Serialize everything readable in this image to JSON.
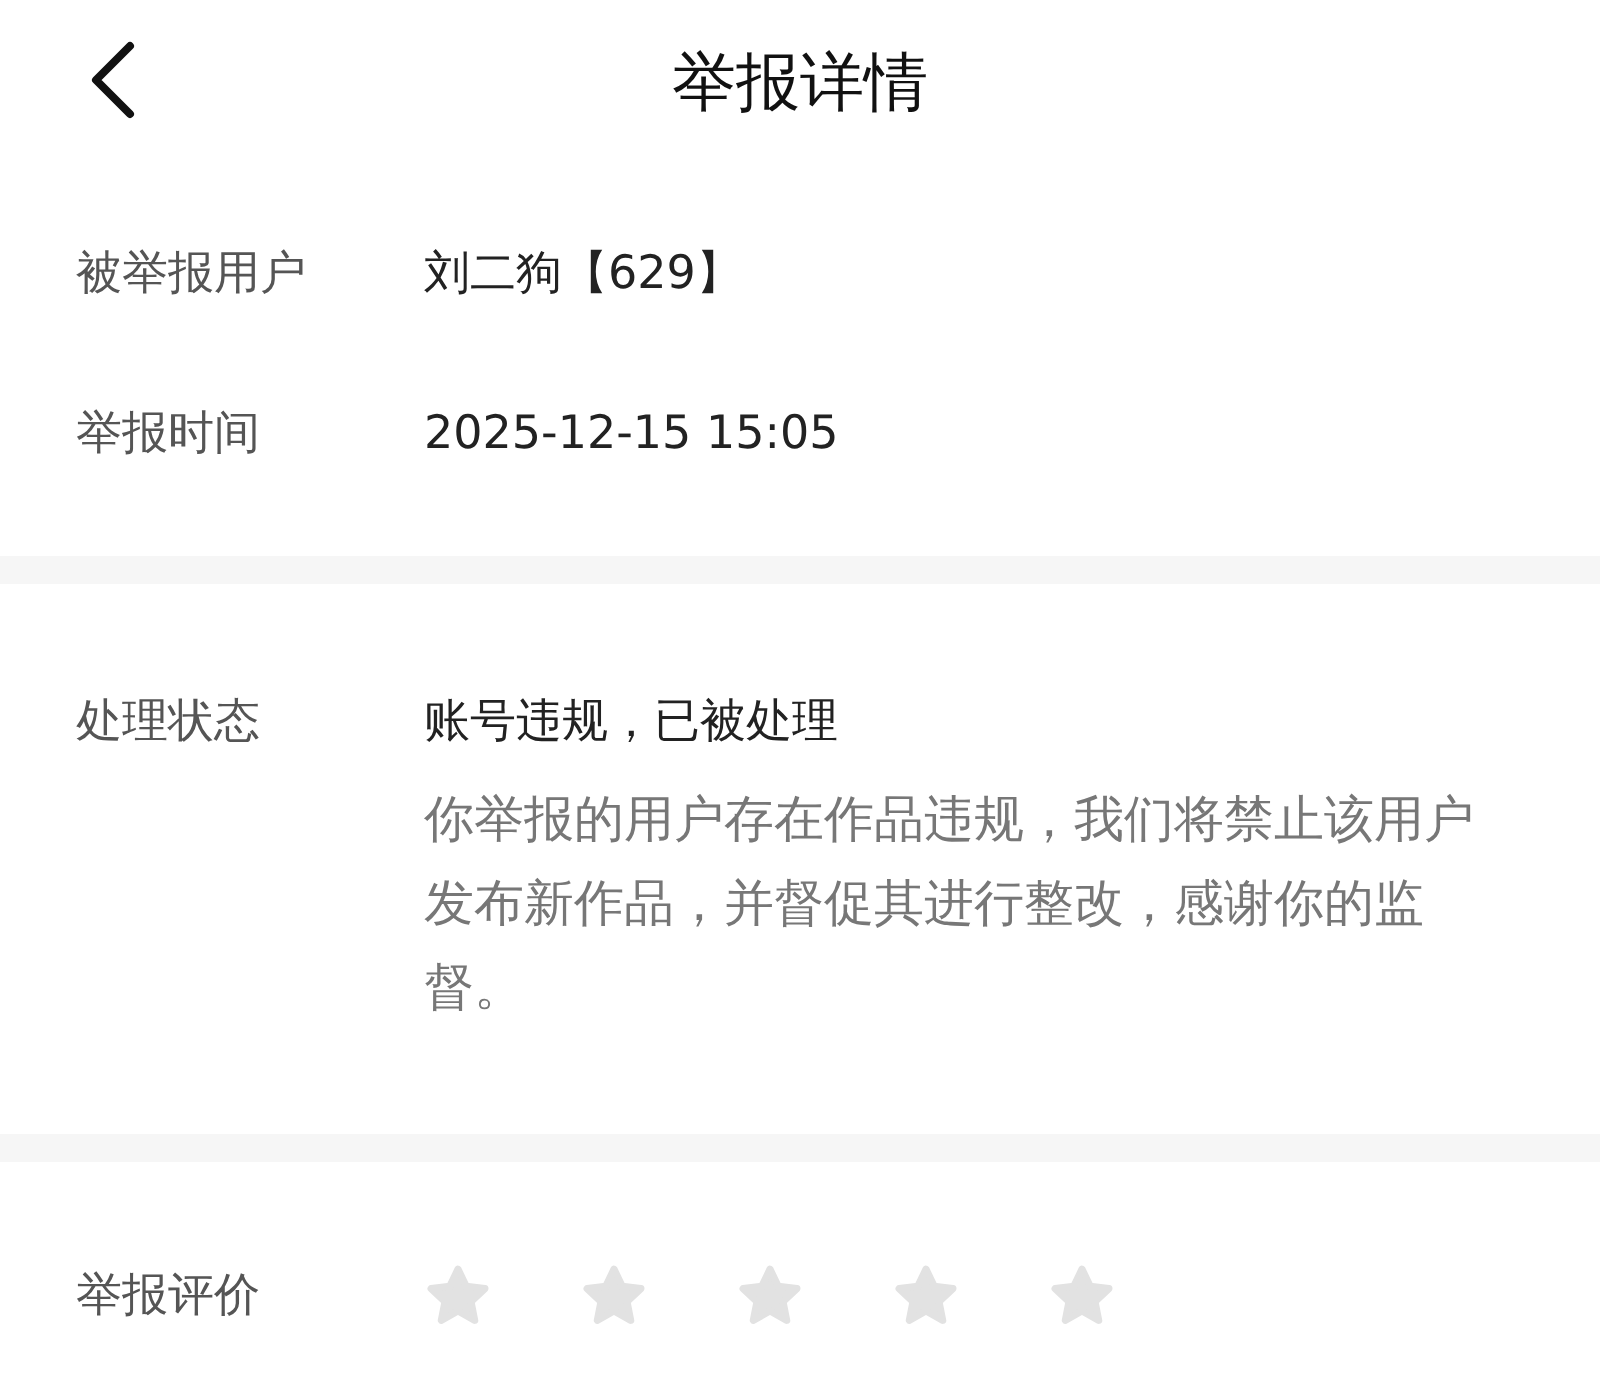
{
  "header": {
    "title": "举报详情"
  },
  "report_info": [
    {
      "label": "被举报用户",
      "value": "刘二狗【629】"
    },
    {
      "label": "举报时间",
      "value": "2025-12-15 15:05"
    }
  ],
  "processing": {
    "label": "处理状态",
    "status": "账号违规，已被处理",
    "description": "你举报的用户存在作品违规，我们将禁止该用户发布新作品，并督促其进行整改，感谢你的监督。"
  },
  "rating": {
    "label": "举报评价",
    "stars": 0
  }
}
